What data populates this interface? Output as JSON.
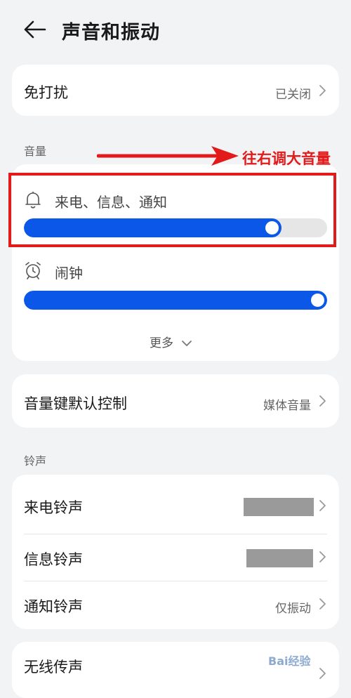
{
  "header": {
    "title": "声音和振动"
  },
  "dnd": {
    "label": "免打扰",
    "value": "已关闭"
  },
  "volume": {
    "section_title": "音量",
    "call_notif": {
      "label": "来电、信息、通知",
      "level": 0.85
    },
    "alarm": {
      "label": "闹钟",
      "level": 1.0
    },
    "more_label": "更多"
  },
  "volume_key": {
    "label": "音量键默认控制",
    "value": "媒体音量"
  },
  "ringtone": {
    "section_title": "铃声",
    "items": [
      {
        "label": "来电铃声",
        "value": ""
      },
      {
        "label": "信息铃声",
        "value": ""
      },
      {
        "label": "通知铃声",
        "value": "仅振动"
      }
    ]
  },
  "wireless": {
    "label": "无线传声"
  },
  "annotation": {
    "text": "往右调大音量",
    "color": "#e21a1a"
  },
  "watermark": {
    "text": "Bai经验"
  },
  "colors": {
    "accent": "#0b57e8",
    "background": "#f1f3f5"
  }
}
